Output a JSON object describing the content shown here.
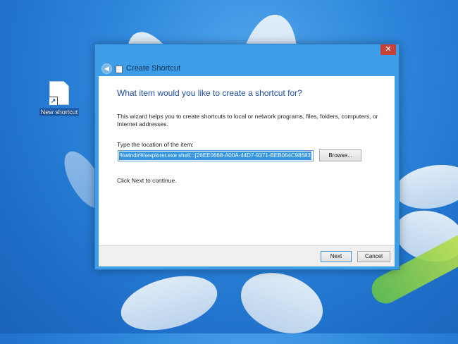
{
  "desktop": {
    "shortcut_label": "New shortcut",
    "shortcut_icon": "document-shortcut-icon"
  },
  "window": {
    "title": "Create Shortcut",
    "close_label": "✕",
    "back_icon": "back-arrow-icon",
    "heading": "What item would you like to create a shortcut for?",
    "description": "This wizard helps you to create shortcuts to local or network programs, files, folders, computers, or Internet addresses.",
    "location_label": "Type the location of the item:",
    "location_value": "%windir%\\explorer.exe shell:::{26EE0668-A00A-44D7-9371-BEB064C98683}",
    "browse_label": "Browse...",
    "hint": "Click Next to continue.",
    "next_label": "Next",
    "cancel_label": "Cancel"
  },
  "colors": {
    "heading": "#1f4d9e",
    "window_frame": "#3d9de6",
    "close_button": "#c7413b",
    "selection": "#3394e0"
  }
}
